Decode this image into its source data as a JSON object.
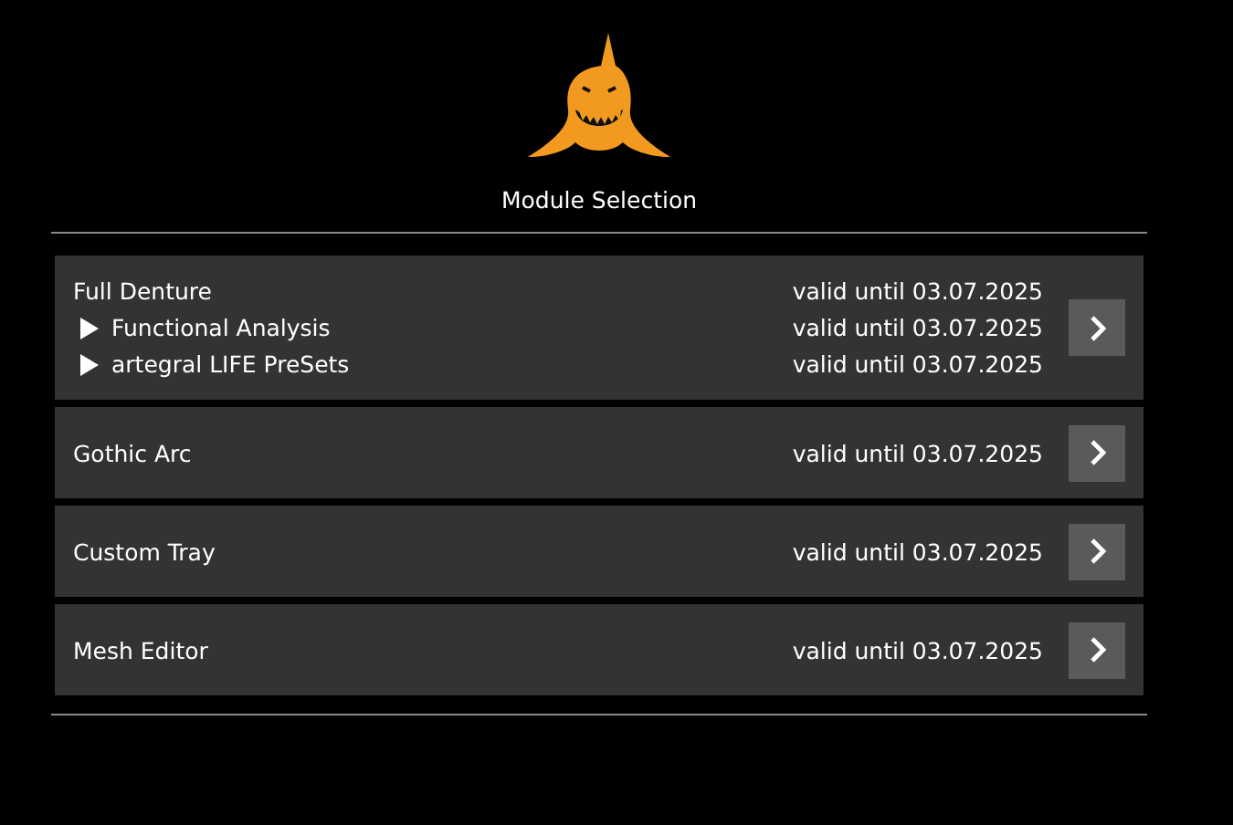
{
  "title": "Module Selection",
  "modules": [
    {
      "name": "Full Denture",
      "validity": "valid until 03.07.2025",
      "children": [
        {
          "name": "Functional Analysis",
          "validity": "valid until 03.07.2025"
        },
        {
          "name": "artegral LIFE PreSets",
          "validity": "valid until 03.07.2025"
        }
      ]
    },
    {
      "name": "Gothic Arc",
      "validity": "valid until 03.07.2025"
    },
    {
      "name": "Custom Tray",
      "validity": "valid until 03.07.2025"
    },
    {
      "name": "Mesh Editor",
      "validity": "valid until 03.07.2025"
    }
  ]
}
